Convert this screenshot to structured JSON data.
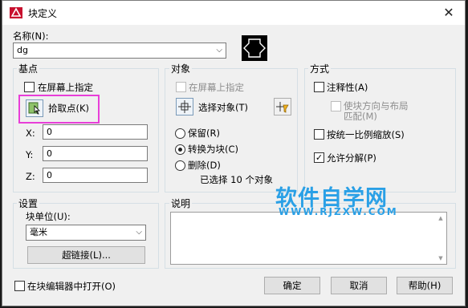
{
  "window": {
    "title": "块定义",
    "close_label": "✕"
  },
  "name": {
    "label": "名称(N):",
    "value": "dg"
  },
  "basepoint": {
    "group_label": "基点",
    "specify_onscreen": "在屏幕上指定",
    "pick_point": "拾取点(K)",
    "x_label": "X:",
    "x_value": "0",
    "y_label": "Y:",
    "y_value": "0",
    "z_label": "Z:",
    "z_value": "0"
  },
  "objects": {
    "group_label": "对象",
    "specify_onscreen": "在屏幕上指定",
    "select_objects": "选择对象(T)",
    "retain": "保留(R)",
    "convert": "转换为块(C)",
    "delete": "删除(D)",
    "selected_count": "已选择 10 个对象"
  },
  "behavior": {
    "group_label": "方式",
    "annotative": "注释性(A)",
    "match_orientation_line1": "使块方向与布局",
    "match_orientation_line2": "匹配(M)",
    "scale_uniformly": "按统一比例缩放(S)",
    "allow_exploding": "允许分解(P)"
  },
  "settings": {
    "group_label": "设置",
    "unit_label": "块单位(U):",
    "unit_value": "毫米",
    "hyperlink": "超链接(L)..."
  },
  "description": {
    "group_label": "说明"
  },
  "footer": {
    "open_in_editor": "在块编辑器中打开(O)",
    "ok": "确定",
    "cancel": "取消",
    "help": "帮助(H)"
  },
  "watermark": {
    "main": "软件自学网",
    "sub": "WWW.RJZXW.COM"
  },
  "colors": {
    "highlight": "#e83ed8",
    "watermark": "#2aa0e6"
  }
}
